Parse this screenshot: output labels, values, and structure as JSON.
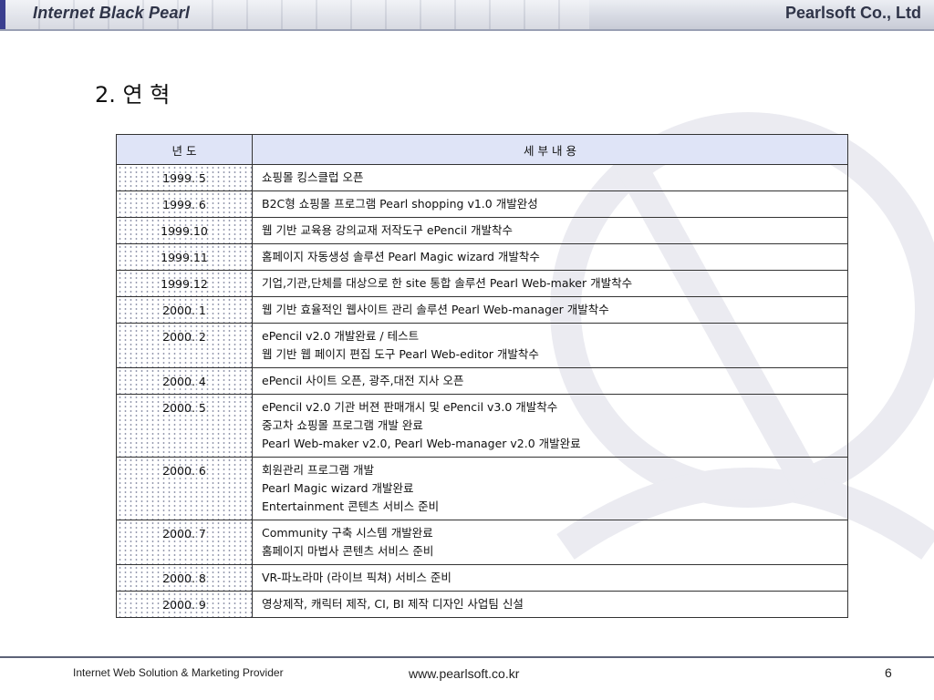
{
  "header": {
    "left_title": "Internet Black Pearl",
    "right_title": "Pearlsoft Co., Ltd"
  },
  "title": "2. 연 혁",
  "table": {
    "col_year": "년 도",
    "col_detail": "세 부 내 용",
    "rows": [
      {
        "year": "1999. 5",
        "lines": [
          "쇼핑몰 킹스클럽 오픈"
        ]
      },
      {
        "year": "1999. 6",
        "lines": [
          "B2C형 쇼핑몰 프로그램 Pearl shopping v1.0 개발완성"
        ]
      },
      {
        "year": "1999.10",
        "lines": [
          "웹 기반 교육용 강의교재 저작도구 ePencil 개발착수"
        ]
      },
      {
        "year": "1999.11",
        "lines": [
          "홈페이지 자동생성 솔루션 Pearl Magic wizard 개발착수"
        ]
      },
      {
        "year": "1999.12",
        "lines": [
          "기업,기관,단체를 대상으로 한 site 통합 솔루션 Pearl Web-maker 개발착수"
        ]
      },
      {
        "year": "2000. 1",
        "lines": [
          "웹 기반 효율적인 웹사이트 관리 솔루션 Pearl Web-manager 개발착수"
        ]
      },
      {
        "year": "2000. 2",
        "lines": [
          "ePencil v2.0 개발완료 / 테스트",
          "웹 기반 웹 페이지 편집 도구 Pearl Web-editor 개발착수"
        ]
      },
      {
        "year": "2000. 4",
        "lines": [
          "ePencil 사이트 오픈, 광주,대전 지사 오픈"
        ]
      },
      {
        "year": "2000. 5",
        "lines": [
          "ePencil v2.0 기관 버젼 판매개시 및 ePencil v3.0 개발착수",
          "중고차 쇼핑몰 프로그램 개발 완료",
          "Pearl Web-maker v2.0, Pearl Web-manager v2.0 개발완료"
        ]
      },
      {
        "year": "2000. 6",
        "lines": [
          "회원관리 프로그램 개발",
          "Pearl Magic wizard 개발완료",
          "Entertainment 콘텐츠 서비스 준비"
        ]
      },
      {
        "year": "2000. 7",
        "lines": [
          "Community 구축 시스템 개발완료",
          "홈페이지 마법사 콘텐츠 서비스 준비"
        ]
      },
      {
        "year": "2000. 8",
        "lines": [
          "VR-파노라마 (라이브 픽쳐) 서비스 준비"
        ]
      },
      {
        "year": "2000. 9",
        "lines": [
          "영상제작, 캐릭터 제작, CI, BI 제작 디자인 사업팀 신설"
        ]
      }
    ]
  },
  "footer": {
    "tagline": "Internet Web Solution & Marketing Provider",
    "url": "www.pearlsoft.co.kr",
    "page": "6"
  }
}
